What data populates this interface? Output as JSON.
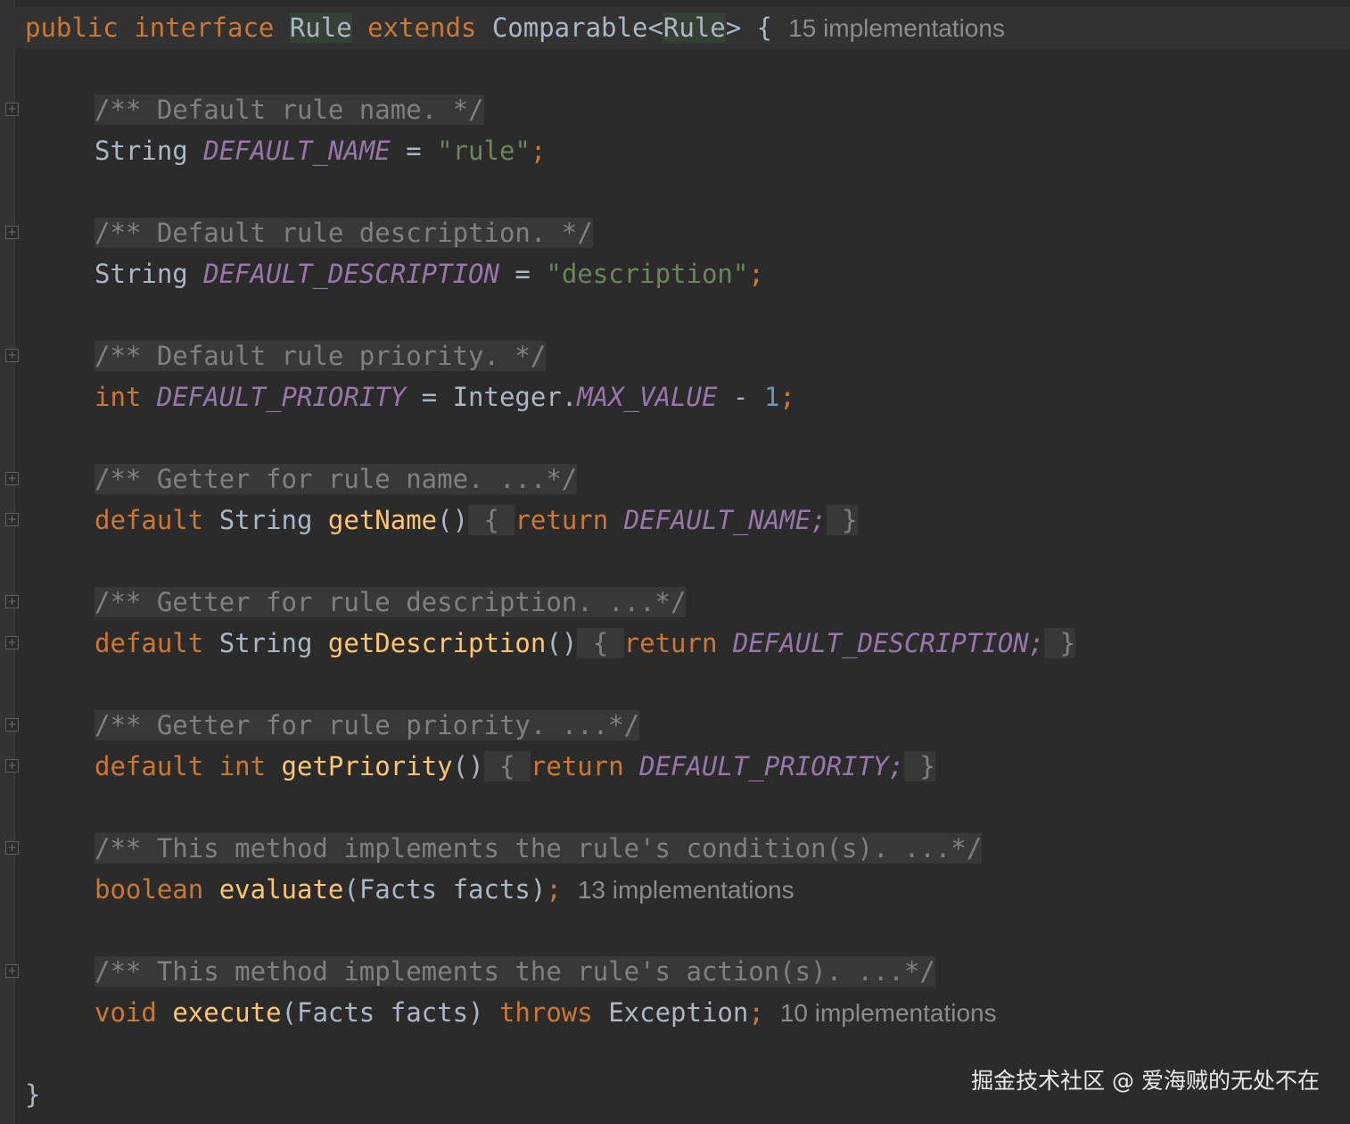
{
  "code": {
    "header": {
      "kw_public": "public",
      "kw_interface": "interface",
      "name": "Rule",
      "kw_extends": "extends",
      "parent": "Comparable<",
      "generic": "Rule",
      "close": "> {",
      "impl_hint": "15 implementations"
    },
    "c1": "/** Default rule name. */",
    "f1": {
      "type": "String",
      "name": "DEFAULT_NAME",
      "eq": " = ",
      "value": "\"rule\"",
      "end": ";"
    },
    "c2": "/** Default rule description. */",
    "f2": {
      "type": "String",
      "name": "DEFAULT_DESCRIPTION",
      "eq": " = ",
      "value": "\"description\"",
      "end": ";"
    },
    "c3": "/** Default rule priority. */",
    "f3": {
      "type": "int",
      "name": "DEFAULT_PRIORITY",
      "eq": " = Integer.",
      "const2": "MAX_VALUE",
      "minus": " - ",
      "num": "1",
      "end": ";"
    },
    "c4": "/** Getter for rule name. ...*/",
    "m1": {
      "kw": "default",
      "type": "String",
      "name": "getName",
      "parens": "()",
      "open": " { ",
      "ret": "return",
      "val": "DEFAULT_NAME;",
      "close": " }"
    },
    "c5": "/** Getter for rule description. ...*/",
    "m2": {
      "kw": "default",
      "type": "String",
      "name": "getDescription",
      "parens": "()",
      "open": " { ",
      "ret": "return",
      "val": "DEFAULT_DESCRIPTION;",
      "close": " }"
    },
    "c6": "/** Getter for rule priority. ...*/",
    "m3": {
      "kw": "default",
      "type": "int",
      "name": "getPriority",
      "parens": "()",
      "open": " { ",
      "ret": "return",
      "val": "DEFAULT_PRIORITY;",
      "close": " }"
    },
    "c7": "/** This method implements the rule's condition(s). ...*/",
    "m4": {
      "type": "boolean",
      "name": "evaluate",
      "params": "(Facts facts)",
      "end": ";",
      "impl_hint": "13 implementations"
    },
    "c8": "/** This method implements the rule's action(s). ...*/",
    "m5": {
      "type": "void",
      "name": "execute",
      "params": "(Facts facts) ",
      "throws": "throws",
      "exc": " Exception",
      "end": ";",
      "impl_hint": "10 implementations"
    },
    "closing": "}"
  },
  "watermark": "掘金技术社区 @ 爱海贼的无处不在",
  "colors": {
    "background": "#2b2b2b",
    "keyword": "#cc7832",
    "comment": "#808080",
    "string": "#6a8759",
    "constant": "#9876aa",
    "method": "#ffc66d",
    "number": "#6897bb",
    "text": "#a9b7c6"
  },
  "icons": {
    "fold_marker": "fold-plus-icon"
  }
}
